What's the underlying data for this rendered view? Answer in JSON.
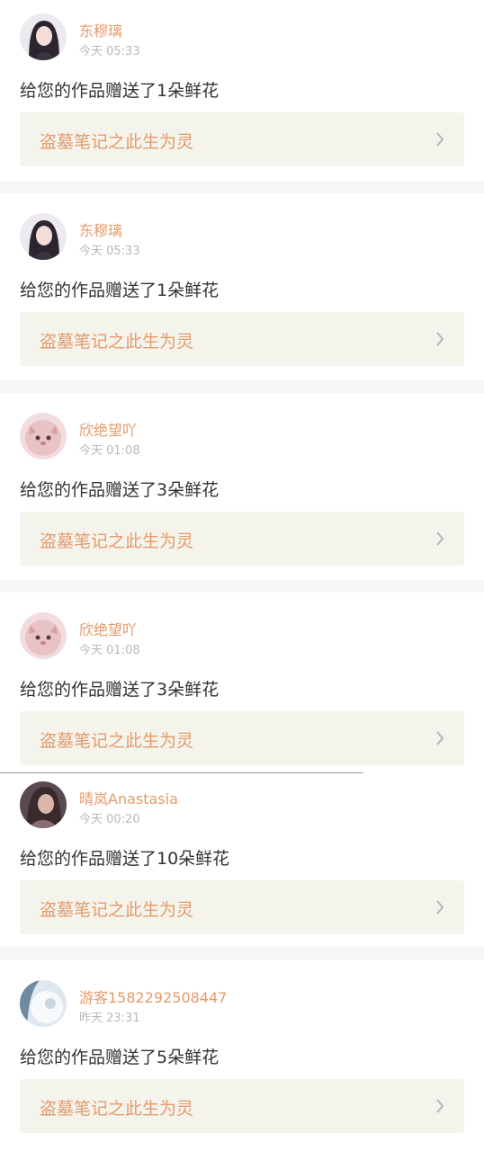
{
  "notifications": [
    {
      "user": "东穆璃",
      "time": "今天 05:33",
      "message": "给您的作品赠送了1朵鲜花",
      "work_title": "盗墓笔记之此生为灵",
      "avatar_icon": "avatar-girl-dark-hair"
    },
    {
      "user": "东穆璃",
      "time": "今天 05:33",
      "message": "给您的作品赠送了1朵鲜花",
      "work_title": "盗墓笔记之此生为灵",
      "avatar_icon": "avatar-girl-dark-hair"
    },
    {
      "user": "欣绝望吖",
      "time": "今天 01:08",
      "message": "给您的作品赠送了3朵鲜花",
      "work_title": "盗墓笔记之此生为灵",
      "avatar_icon": "avatar-pink-cat"
    },
    {
      "user": "欣绝望吖",
      "time": "今天 01:08",
      "message": "给您的作品赠送了3朵鲜花",
      "work_title": "盗墓笔记之此生为灵",
      "avatar_icon": "avatar-pink-cat"
    },
    {
      "user": "晴岚Anastasia",
      "time": "今天 00:20",
      "message": "给您的作品赠送了10朵鲜花",
      "work_title": "盗墓笔记之此生为灵",
      "avatar_icon": "avatar-girl-brown-hair"
    },
    {
      "user": "游客1582292508447",
      "time": "昨天 23:31",
      "message": "给您的作品赠送了5朵鲜花",
      "work_title": "盗墓笔记之此生为灵",
      "avatar_icon": "avatar-blue-white"
    }
  ],
  "colors": {
    "accent": "#e49b6b",
    "work_bg": "#f4f3ec",
    "time": "#b9b9b9",
    "message": "#333333"
  }
}
